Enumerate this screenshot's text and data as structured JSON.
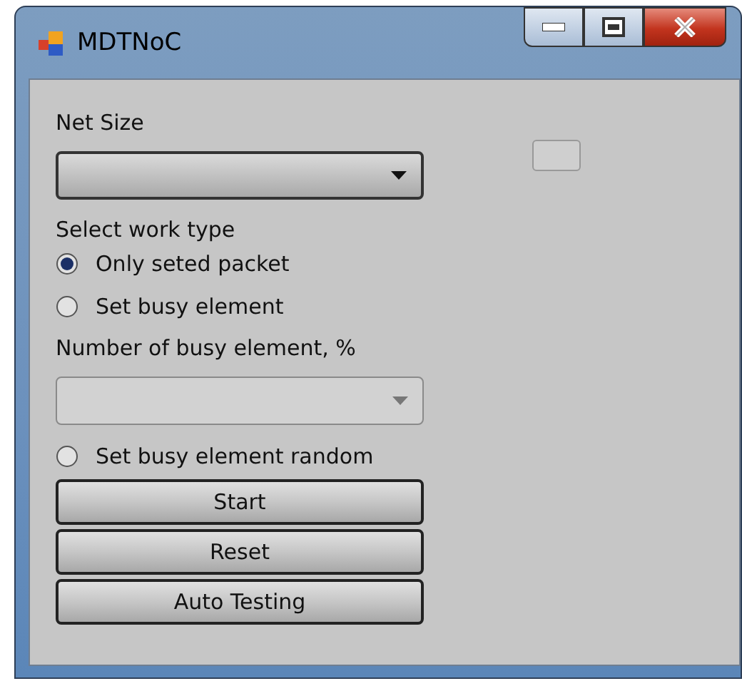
{
  "window": {
    "title": "MDTNoC"
  },
  "controls": [
    {
      "kind": "label",
      "text": "Net Size"
    },
    {
      "kind": "combo",
      "disabled": false,
      "blank_beside": true
    },
    {
      "kind": "label",
      "text": "Select work type"
    },
    {
      "kind": "radio",
      "label": "Only seted packet",
      "selected": true
    },
    {
      "kind": "radio",
      "label": "Set busy element",
      "selected": false
    },
    {
      "kind": "label",
      "text": "Number of busy element, %"
    },
    {
      "kind": "combo",
      "disabled": true
    },
    {
      "kind": "radio",
      "label": "Set busy element random",
      "selected": false
    },
    {
      "kind": "button",
      "label": "Start"
    },
    {
      "kind": "button",
      "label": "Reset"
    },
    {
      "kind": "button",
      "label": "Auto Testing"
    }
  ]
}
